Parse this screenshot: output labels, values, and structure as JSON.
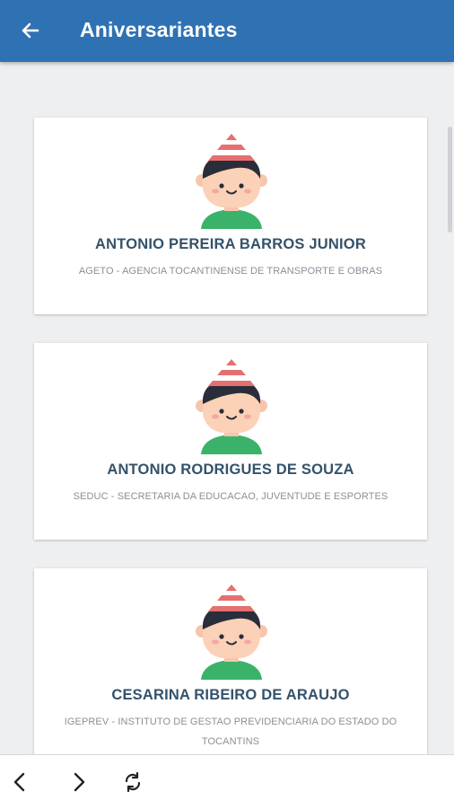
{
  "header": {
    "title": "Aniversariantes",
    "back_icon": "arrow-left-icon"
  },
  "people": [
    {
      "name": "ANTONIO PEREIRA BARROS JUNIOR",
      "org": "AGETO - AGENCIA TOCANTINENSE DE TRANSPORTE E OBRAS",
      "avatar_icon": "party-boy-avatar-icon"
    },
    {
      "name": "ANTONIO RODRIGUES DE SOUZA",
      "org": "SEDUC - SECRETARIA DA EDUCACAO, JUVENTUDE E ESPORTES",
      "avatar_icon": "party-boy-avatar-icon"
    },
    {
      "name": "CESARINA RIBEIRO DE ARAUJO",
      "org": "IGEPREV - INSTITUTO DE GESTAO PREVIDENCIARIA DO ESTADO DO TOCANTINS",
      "avatar_icon": "party-boy-avatar-icon"
    }
  ],
  "bottom_nav": {
    "back_icon": "chevron-left-icon",
    "forward_icon": "chevron-right-icon",
    "refresh_icon": "refresh-icon"
  },
  "colors": {
    "app_bar": "#2f72b4",
    "name_text": "#34526a",
    "org_text": "#8a8f96",
    "background": "#eeeff1",
    "hat_stripe": "#e4706f",
    "shirt": "#3bb26a"
  }
}
